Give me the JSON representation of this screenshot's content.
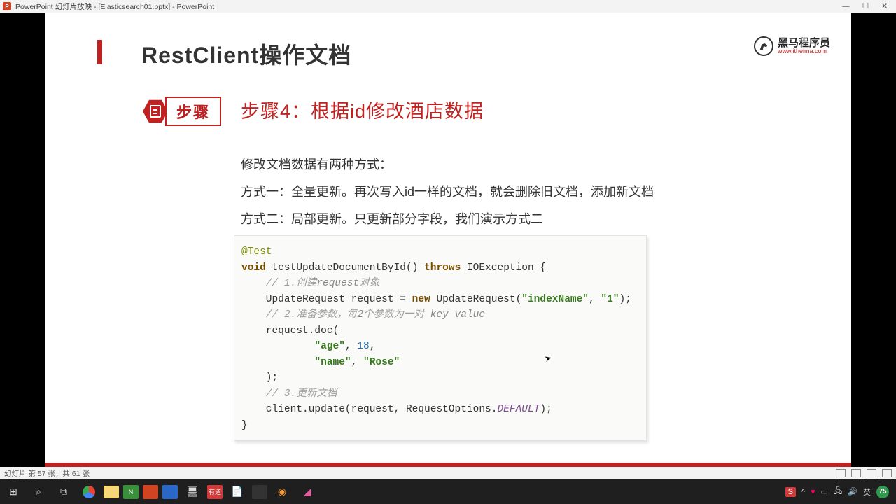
{
  "window": {
    "title": "PowerPoint 幻灯片放映 - [Elasticsearch01.pptx] - PowerPoint",
    "min": "—",
    "max": "☐",
    "close": "✕"
  },
  "slide": {
    "title": "RestClient操作文档",
    "brand_text": "黑马程序员",
    "brand_url": "www.itheima.com",
    "step_label": "步骤",
    "step_title": "步骤4：根据id修改酒店数据",
    "paragraph1": "修改文档数据有两种方式：",
    "paragraph2": "方式一：全量更新。再次写入id一样的文档，就会删除旧文档，添加新文档",
    "paragraph3": "方式二：局部更新。只更新部分字段，我们演示方式二"
  },
  "code": {
    "annotation": "@Test",
    "kw_void": "void",
    "method": " testUpdateDocumentById() ",
    "kw_throws": "throws",
    "throws_tail": " IOException {",
    "c1a": "// 1.创建",
    "c1b": "request",
    "c1c": "对象",
    "line_req_a": "    UpdateRequest request = ",
    "kw_new": "new",
    "line_req_b": " UpdateRequest(",
    "str_index": "\"indexName\"",
    "line_req_c": ", ",
    "str_one": "\"1\"",
    "line_req_d": ");",
    "c2a": "// 2.准备参数，每",
    "c2b": "2",
    "c2c": "个参数为一对 ",
    "c2d": "key value",
    "doc_open": "    request.doc(",
    "str_age": "\"age\"",
    "num_18": "18",
    "str_name": "\"name\"",
    "str_rose": "\"Rose\"",
    "doc_close": "    );",
    "c3": "// 3.更新文档",
    "update_a": "    client.update(request, RequestOptions.",
    "const_default": "DEFAULT",
    "update_b": ");",
    "brace": "}"
  },
  "status": {
    "left": "幻灯片 第 57 张，共 61 张"
  },
  "tray": {
    "ime": "英",
    "badge": "75"
  }
}
